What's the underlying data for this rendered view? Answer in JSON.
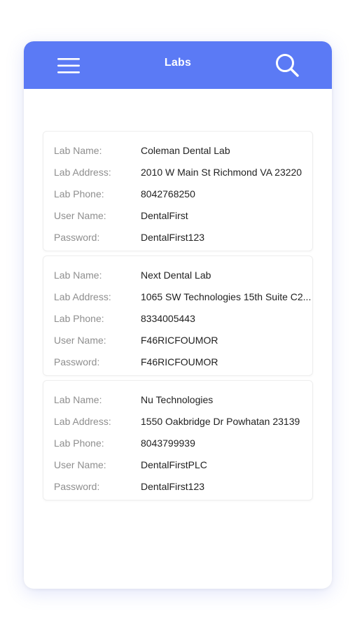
{
  "header": {
    "title": "Labs",
    "menu_icon": "hamburger-menu-icon",
    "search_icon": "search-icon",
    "accent_color": "#5b7af5"
  },
  "labs": [
    {
      "name_label": "Lab Name:",
      "name": "Coleman Dental Lab",
      "address_label": "Lab Address:",
      "address": "2010 W Main St Richmond VA 23220",
      "phone_label": "Lab Phone:",
      "phone": "8042768250",
      "username_label": "User Name:",
      "username": "DentalFirst",
      "password_label": "Password:",
      "password": "DentalFirst123"
    },
    {
      "name_label": "Lab Name:",
      "name": "Next Dental Lab",
      "address_label": "Lab Address:",
      "address": "1065 SW Technologies 15th Suite C2...",
      "phone_label": "Lab Phone:",
      "phone": "8334005443",
      "username_label": "User Name:",
      "username": "F46RICFOUMOR",
      "password_label": "Password:",
      "password": "F46RICFOUMOR"
    },
    {
      "name_label": "Lab Name:",
      "name": "Nu Technologies",
      "address_label": "Lab Address:",
      "address": "1550 Oakbridge Dr Powhatan 23139",
      "phone_label": "Lab Phone:",
      "phone": "8043799939",
      "username_label": "User Name:",
      "username": "DentalFirstPLC",
      "password_label": "Password:",
      "password": "DentalFirst123"
    }
  ]
}
